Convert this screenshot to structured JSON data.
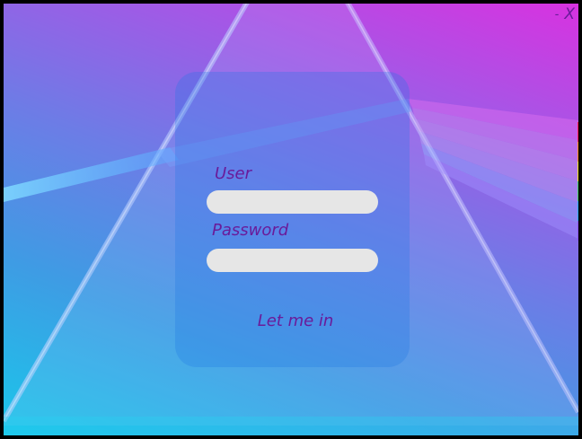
{
  "window": {
    "minimize_label": "-",
    "close_label": "X"
  },
  "login": {
    "user_label": "User",
    "user_value": "",
    "password_label": "Password",
    "password_value": "",
    "submit_label": "Let me in"
  },
  "colors": {
    "label_text": "#6a1b9a",
    "field_background": "#e6e6e6",
    "gradient_top_right": "#d832e0",
    "gradient_bottom_left": "#1ac6ea",
    "spectrum": [
      "#ff1a55",
      "#ff8a1a",
      "#f5e21a",
      "#45d36a",
      "#2aa8f5",
      "#8a52f0"
    ]
  }
}
